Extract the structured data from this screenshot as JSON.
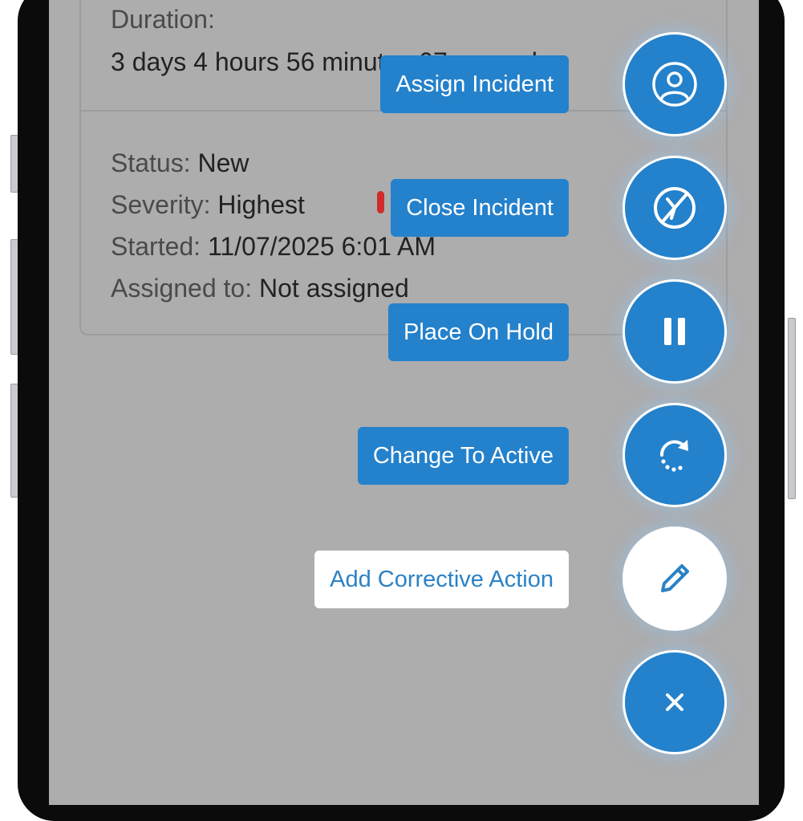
{
  "card": {
    "duration_label": "Duration:",
    "duration_value": "3 days 4 hours 56 minutes 07 seconds",
    "status_label": "Status:",
    "status_value": "New",
    "severity_label": "Severity:",
    "severity_value": "Highest",
    "severity_level": 4,
    "started_label": "Started:",
    "started_value": "11/07/2025 6:01 AM",
    "assigned_label": "Assigned to:",
    "assigned_value": "Not assigned"
  },
  "actions": [
    {
      "label": "Assign Incident",
      "icon": "user-circle-icon"
    },
    {
      "label": "Close Incident",
      "icon": "close-incident-icon"
    },
    {
      "label": "Place On Hold",
      "icon": "pause-icon"
    },
    {
      "label": "Change To Active",
      "icon": "redo-icon"
    },
    {
      "label": "Add Corrective Action",
      "icon": "pencil-icon"
    }
  ],
  "close_menu_icon": "close-icon",
  "colors": {
    "accent": "#2481cb",
    "overlay": "#adadae",
    "severity": "#d12c2c"
  }
}
